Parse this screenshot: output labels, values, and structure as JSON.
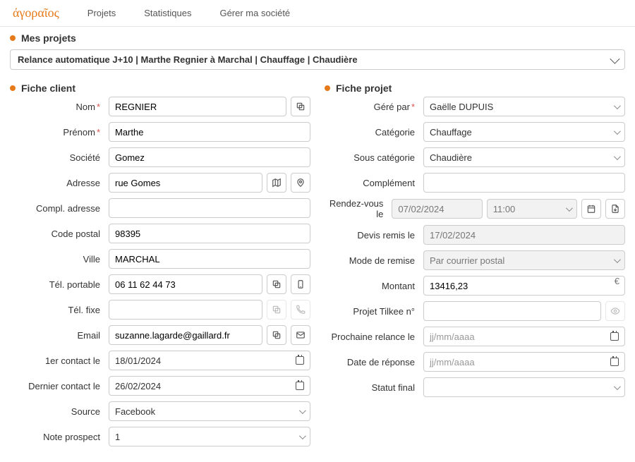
{
  "brand": "άγοραῖος",
  "nav": {
    "projets": "Projets",
    "stats": "Statistiques",
    "societe": "Gérer ma société"
  },
  "sections": {
    "mes_projets": "Mes projets",
    "fiche_client": "Fiche client",
    "fiche_projet": "Fiche projet"
  },
  "project_bar": "Relance automatique J+10 | Marthe Regnier à Marchal | Chauffage | Chaudière",
  "client": {
    "labels": {
      "nom": "Nom",
      "prenom": "Prénom",
      "societe": "Société",
      "adresse": "Adresse",
      "compl": "Compl. adresse",
      "cp": "Code postal",
      "ville": "Ville",
      "tel_port": "Tél. portable",
      "tel_fixe": "Tél. fixe",
      "email": "Email",
      "contact1": "1er contact le",
      "contact_last": "Dernier contact le",
      "source": "Source",
      "note": "Note prospect"
    },
    "values": {
      "nom": "REGNIER",
      "prenom": "Marthe",
      "societe": "Gomez",
      "adresse": "rue Gomes",
      "compl": "",
      "cp": "98395",
      "ville": "MARCHAL",
      "tel_port": "06 11 62 44 73",
      "tel_fixe": "",
      "email": "suzanne.lagarde@gaillard.fr",
      "contact1": "18/01/2024",
      "contact_last": "26/02/2024",
      "source": "Facebook",
      "note": "1"
    }
  },
  "projet": {
    "labels": {
      "gere": "Géré par",
      "categorie": "Catégorie",
      "sous_cat": "Sous catégorie",
      "complement": "Complément",
      "rdv": "Rendez-vous le",
      "devis": "Devis remis le",
      "mode": "Mode de remise",
      "montant": "Montant",
      "tilkee": "Projet Tilkee n°",
      "relance": "Prochaine relance le",
      "reponse": "Date de réponse",
      "statut": "Statut final"
    },
    "values": {
      "gere": "Gaëlle DUPUIS",
      "categorie": "Chauffage",
      "sous_cat": "Chaudière",
      "complement": "",
      "rdv_date": "07/02/2024",
      "rdv_time": "11:00",
      "devis": "17/02/2024",
      "mode": "Par courrier postal",
      "montant": "13416,23",
      "currency": "€",
      "tilkee": "",
      "relance_ph": "jj/mm/aaaa",
      "reponse_ph": "jj/mm/aaaa",
      "statut": ""
    }
  }
}
